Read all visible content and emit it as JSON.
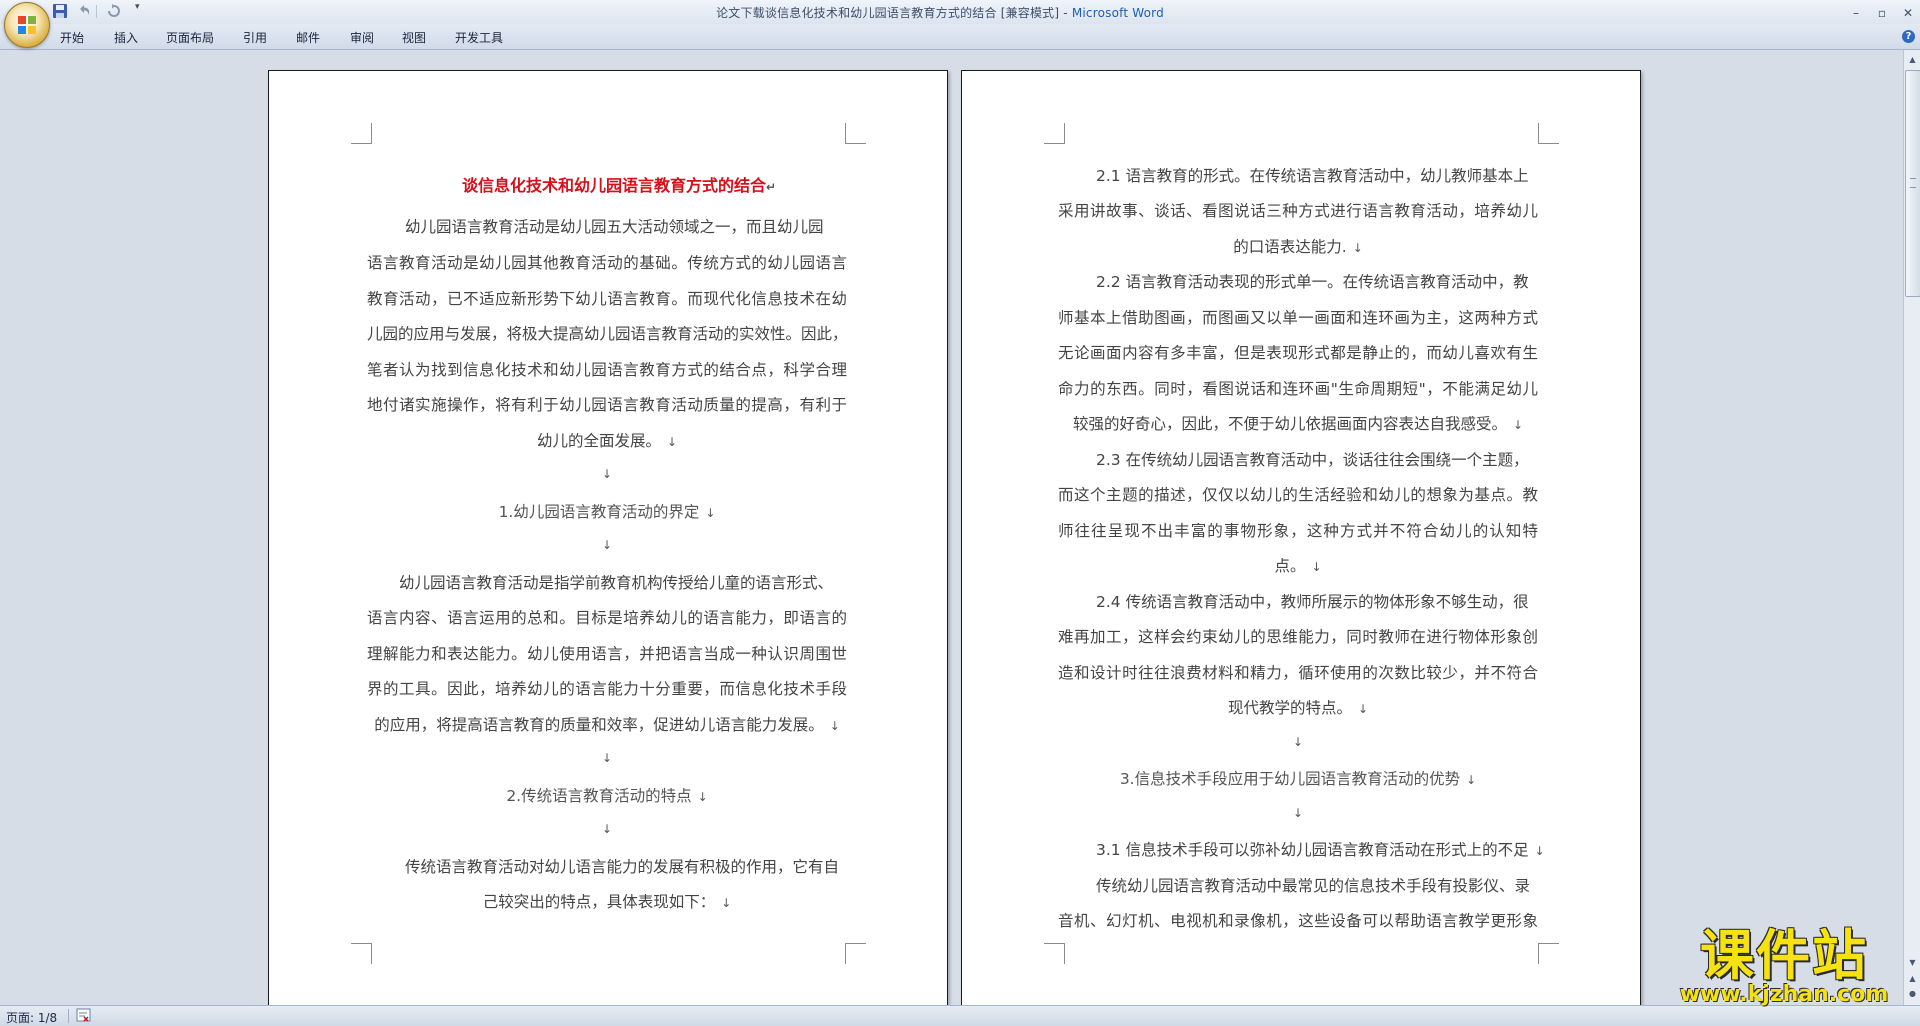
{
  "window": {
    "title": "论文下载谈信息化技术和幼儿园语言教育方式的结合 [兼容模式]",
    "title_sep": " - ",
    "app_name": "Microsoft Word"
  },
  "ribbon": {
    "tabs": [
      "开始",
      "插入",
      "页面布局",
      "引用",
      "邮件",
      "审阅",
      "视图",
      "开发工具"
    ]
  },
  "page1": {
    "lines": [
      "谈信息化技术和幼儿园语言教育方式的结合",
      "幼儿园语言教育活动是幼儿园五大活动领域之一，而且幼儿园",
      "语言教育活动是幼儿园其他教育活动的基础。传统方式的幼儿园语言",
      "教育活动，已不适应新形势下幼儿语言教育。而现代化信息技术在幼",
      "儿园的应用与发展，将极大提高幼儿园语言教育活动的实效性。因此，",
      "笔者认为找到信息化技术和幼儿园语言教育方式的结合点，科学合理",
      "地付诸实施操作，将有利于幼儿园语言教育活动质量的提高，有利于",
      "幼儿的全面发展。",
      "",
      "1.幼儿园语言教育活动的界定",
      "",
      "幼儿园语言教育活动是指学前教育机构传授给儿童的语言形式、",
      "语言内容、语言运用的总和。目标是培养幼儿的语言能力，即语言的",
      "理解能力和表达能力。幼儿使用语言，并把语言当成一种认识周围世",
      "界的工具。因此，培养幼儿的语言能力十分重要，而信息化技术手段",
      "的应用，将提高语言教育的质量和效率，促进幼儿语言能力发展。",
      "",
      "2.传统语言教育活动的特点",
      "",
      "传统语言教育活动对幼儿语言能力的发展有积极的作用，它有自",
      "己较突出的特点，具体表现如下："
    ]
  },
  "page2": {
    "lines": [
      "2.1 语言教育的形式。在传统语言教育活动中，幼儿教师基本上",
      "采用讲故事、谈话、看图说话三种方式进行语言教育活动，培养幼儿",
      "的口语表达能力.",
      "2.2 语言教育活动表现的形式单一。在传统语言教育活动中，教",
      "师基本上借助图画，而图画又以单一画面和连环画为主，这两种方式",
      "无论画面内容有多丰富，但是表现形式都是静止的，而幼儿喜欢有生",
      "命力的东西。同时，看图说话和连环画\"生命周期短\"，不能满足幼儿",
      "较强的好奇心，因此，不便于幼儿依据画面内容表达自我感受。",
      "2.3 在传统幼儿园语言教育活动中，谈话往往会围绕一个主题，",
      "而这个主题的描述，仅仅以幼儿的生活经验和幼儿的想象为基点。教",
      "师往往呈现不出丰富的事物形象，这种方式并不符合幼儿的认知特",
      "点。",
      "2.4 传统语言教育活动中，教师所展示的物体形象不够生动，很",
      "难再加工，这样会约束幼儿的思维能力，同时教师在进行物体形象创",
      "造和设计时往往浪费材料和精力，循环使用的次数比较少，并不符合",
      "现代教学的特点。",
      "",
      "3.信息技术手段应用于幼儿园语言教育活动的优势",
      "",
      "3.1 信息技术手段可以弥补幼儿园语言教育活动在形式上的不足",
      "传统幼儿园语言教育活动中最常见的信息技术手段有投影仪、录",
      "音机、幻灯机、电视机和录像机，这些设备可以帮助语言教学更形象"
    ]
  },
  "status": {
    "page_info": "页面: 1/8"
  },
  "watermark": {
    "name": "课件站",
    "url": "www.kjzhan.com"
  },
  "colors": {
    "title_red": "#d6101b",
    "brand_blue": "#1c5fb4",
    "watermark_yellow": "#f5e210"
  }
}
